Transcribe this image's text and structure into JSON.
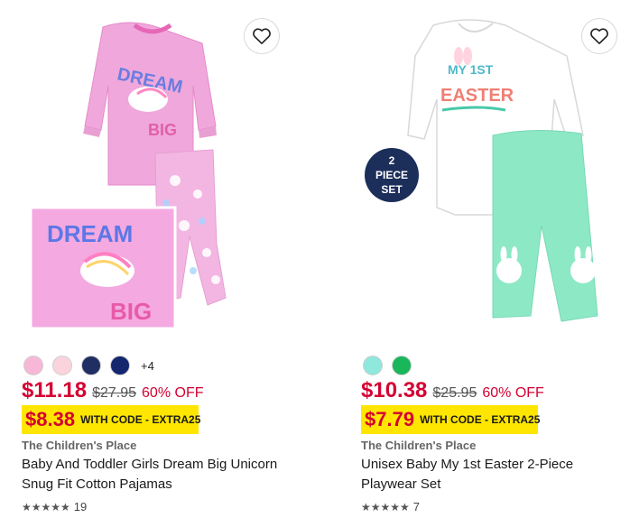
{
  "products": [
    {
      "swatches": [
        "#f6b8d6",
        "#fbd3dd",
        "#1f2f63",
        "#14266e"
      ],
      "more_swatches": "+4",
      "price": "$11.18",
      "original_price": "$27.95",
      "discount": "60% OFF",
      "promo_price": "$8.38",
      "promo_text": "WITH CODE - EXTRA25",
      "brand": "The Children's Place",
      "title": "Baby And Toddler Girls Dream Big Unicorn Snug Fit Cotton Pajamas",
      "rating_stars": "★★★★★",
      "rating_count": "19",
      "image_text_1": "DREAM",
      "image_text_2": "BIG"
    },
    {
      "swatches": [
        "#8fe8dc",
        "#19b65a"
      ],
      "price": "$10.38",
      "original_price": "$25.95",
      "discount": "60% OFF",
      "promo_price": "$7.79",
      "promo_text": "WITH CODE - EXTRA25",
      "brand": "The Children's Place",
      "title": "Unisex Baby My 1st Easter 2-Piece Playwear Set",
      "rating_stars": "★★★★★",
      "rating_count": "7",
      "badge_line1": "2",
      "badge_line2": "PIECE",
      "badge_line3": "SET",
      "image_text_1": "MY 1ST",
      "image_text_2": "EASTER"
    }
  ],
  "colors": {
    "sale_red": "#d50032",
    "promo_yellow": "#ffe600"
  }
}
